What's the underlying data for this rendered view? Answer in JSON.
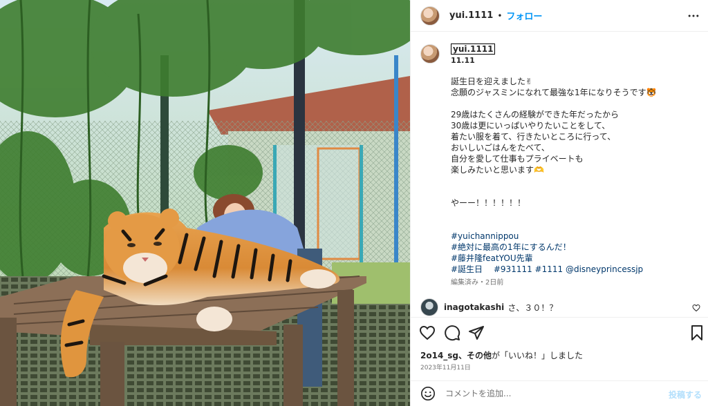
{
  "post": {
    "username": "yui.1111",
    "follow_label": "フォロー",
    "separator": "•"
  },
  "caption": {
    "username": "yui.1111",
    "date": "11.11",
    "lines": [
      "誕生日を迎えました✌",
      "念願のジャスミンになれて最強な1年になりそうです🐯",
      "",
      "29歳はたくさんの経験ができた年だったから",
      "30歳は更にいっぱいやりたいことをして、",
      "着たい服を着て、行きたいところに行って、",
      "おいしいごはんをたべて、",
      "自分を愛して仕事もプライベートも",
      "楽しみたいと思います🫶",
      "",
      "",
      "やーー！！！！！！",
      "",
      ""
    ],
    "hashtags": [
      "#yuichannippou",
      "#絶対に最高の1年にするんだ！",
      "#藤井隆featYOU先輩",
      "#誕生日　 #931111 #1111 @disneyprincessjp"
    ],
    "edited_label": "編集済み・2日前"
  },
  "comment": {
    "username": "inagotakashi",
    "text": "さ、３０！？"
  },
  "likes": {
    "user": "2o14_sg",
    "others": "、その他",
    "suffix": "が「いいね！」しました"
  },
  "post_date": "2023年11月11日",
  "add_comment": {
    "placeholder": "コメントを追加...",
    "post_label": "投稿する"
  },
  "icons": {
    "more": "more-horizontal-icon",
    "like": "heart-icon",
    "comment": "comment-bubble-icon",
    "share": "paper-plane-icon",
    "save": "bookmark-icon",
    "emoji": "smiley-icon"
  },
  "colors": {
    "link": "#0095f6",
    "hashtag": "#00376b",
    "muted": "#737373",
    "post_disabled": "#b2dffc"
  }
}
